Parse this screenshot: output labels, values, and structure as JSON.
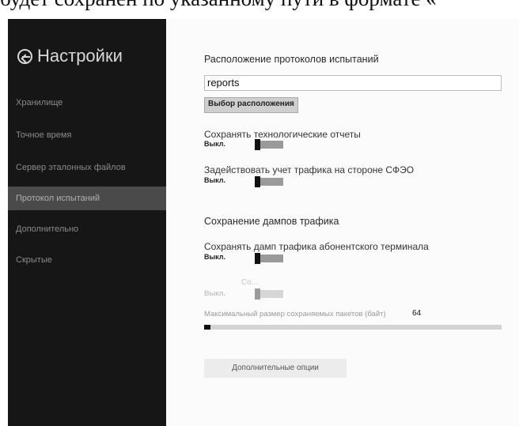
{
  "document_text": "будет сохранен по указанному пути в формате «",
  "sidebar": {
    "title": "Настройки",
    "items": [
      {
        "label": "Хранилище"
      },
      {
        "label": "Точное время"
      },
      {
        "label": "Сервер эталонных файлов"
      },
      {
        "label": "Протокол испытаний"
      },
      {
        "label": "Дополнительно"
      },
      {
        "label": "Скрытые"
      }
    ]
  },
  "main": {
    "location_title": "Расположение протоколов испытаний",
    "location_value": "reports",
    "choose_location_label": "Выбор расположения",
    "save_tech_reports": {
      "label": "Сохранять технологические отчеты",
      "state": "Выкл."
    },
    "traffic_accounting": {
      "label": "Задействовать учет трафика на стороне СФЭО",
      "state": "Выкл."
    },
    "dumps_title": "Сохранение дампов трафика",
    "save_terminal_dump": {
      "label": "Сохранять дамп трафика абонентского терминала",
      "state": "Выкл."
    },
    "disabled_toggle": {
      "label": "Со...",
      "state": "Выкл."
    },
    "max_packet_size": {
      "label": "Максимальный размер сохраняемых пакетов (байт)",
      "value": "64",
      "fraction": 0.02
    },
    "more_options_label": "Дополнительные опции"
  },
  "icons": {
    "back": "back-arrow-circle-icon"
  },
  "colors": {
    "sidebar_bg": "#161616",
    "active_item_bg": "#4a4a4a",
    "main_bg": "#fbfbfb"
  }
}
